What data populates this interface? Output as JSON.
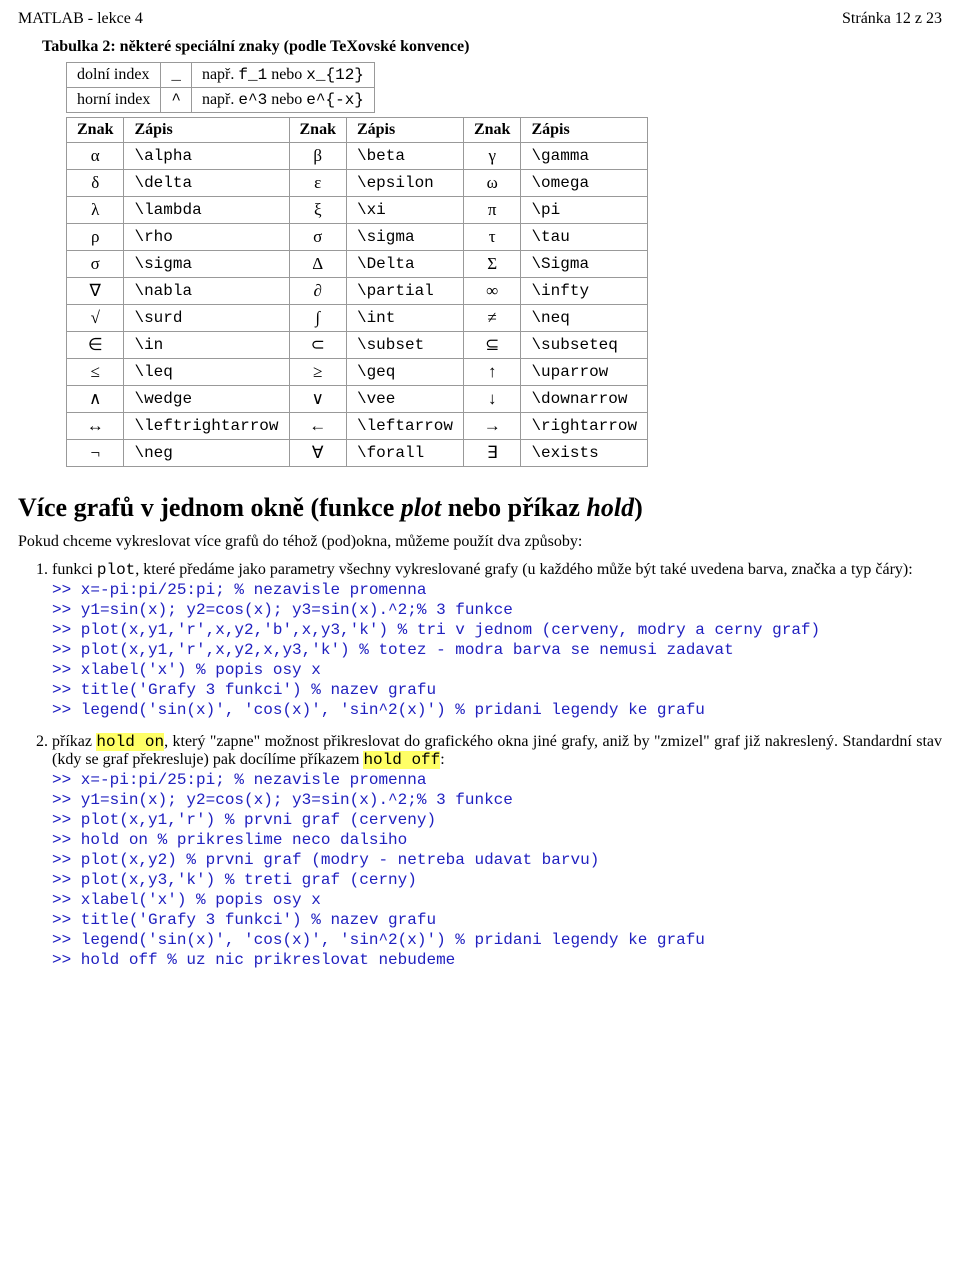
{
  "header": {
    "left": "MATLAB - lekce 4",
    "right": "Stránka 12 z 23"
  },
  "table2": {
    "caption": "Tabulka 2: některé speciální znaky (podle TeXovské konvence)",
    "rows": [
      [
        "dolní index",
        "_",
        "např.",
        "f_1",
        "nebo",
        "x_{12}"
      ],
      [
        "horní index",
        "^",
        "např.",
        "e^3",
        "nebo",
        "e^{-x}"
      ]
    ],
    "hdr": [
      "Znak",
      "Zápis",
      "Znak",
      "Zápis",
      "Znak",
      "Zápis"
    ],
    "body": [
      [
        "α",
        "\\alpha",
        "β",
        "\\beta",
        "γ",
        "\\gamma"
      ],
      [
        "δ",
        "\\delta",
        "ε",
        "\\epsilon",
        "ω",
        "\\omega"
      ],
      [
        "λ",
        "\\lambda",
        "ξ",
        "\\xi",
        "π",
        "\\pi"
      ],
      [
        "ρ",
        "\\rho",
        "σ",
        "\\sigma",
        "τ",
        "\\tau"
      ],
      [
        "σ",
        "\\sigma",
        "Δ",
        "\\Delta",
        "Σ",
        "\\Sigma"
      ],
      [
        "∇",
        "\\nabla",
        "∂",
        "\\partial",
        "∞",
        "\\infty"
      ],
      [
        "√",
        "\\surd",
        "∫",
        "\\int",
        "≠",
        "\\neq"
      ],
      [
        "∈",
        "\\in",
        "⊂",
        "\\subset",
        "⊆",
        "\\subseteq"
      ],
      [
        "≤",
        "\\leq",
        "≥",
        "\\geq",
        "↑",
        "\\uparrow"
      ],
      [
        "∧",
        "\\wedge",
        "∨",
        "\\vee",
        "↓",
        "\\downarrow"
      ],
      [
        "↔",
        "\\leftrightarrow",
        "←",
        "\\leftarrow",
        "→",
        "\\rightarrow"
      ],
      [
        "¬",
        "\\neg",
        "∀",
        "\\forall",
        "∃",
        "\\exists"
      ]
    ]
  },
  "sectionTitle": [
    "Více grafů v jednom okně (funkce ",
    "plot",
    " nebo příkaz ",
    "hold",
    ")"
  ],
  "intro": "Pokud chceme vykreslovat více grafů do téhož (pod)okna, můžeme použít dva způsoby:",
  "item1": {
    "lead": [
      "funkci ",
      "plot",
      ", které předáme jako parametry všechny vykreslované grafy (u každého může být také uvedena barva, značka a typ čáry):"
    ],
    "code": [
      ">> x=-pi:pi/25:pi; % nezavisle promenna",
      ">> y1=sin(x); y2=cos(x); y3=sin(x).^2;% 3 funkce",
      ">> plot(x,y1,'r',x,y2,'b',x,y3,'k') % tri v jednom (cerveny, modry a cerny graf)",
      ">> plot(x,y1,'r',x,y2,x,y3,'k') % totez - modra barva se nemusi zadavat",
      ">> xlabel('x') % popis osy x",
      ">> title('Grafy 3 funkci') % nazev grafu",
      ">> legend('sin(x)', 'cos(x)', 'sin^2(x)') % pridani legendy ke grafu"
    ]
  },
  "item2": {
    "lead1": "příkaz ",
    "hi1": "hold on",
    "lead2": ", který \"zapne\" možnost přikreslovat do grafického okna jiné grafy, aniž by \"zmizel\" graf již nakreslený. Standardní stav (kdy se graf překresluje) pak docílíme příkazem ",
    "hi2": "hold off",
    "lead3": ":",
    "code": [
      ">> x=-pi:pi/25:pi; % nezavisle promenna",
      ">> y1=sin(x); y2=cos(x); y3=sin(x).^2;% 3 funkce",
      ">> plot(x,y1,'r') % prvni graf (cerveny)",
      ">> hold on % prikreslime neco dalsiho",
      ">> plot(x,y2) % prvni graf (modry - netreba udavat barvu)",
      ">> plot(x,y3,'k') % treti graf (cerny)",
      ">> xlabel('x') % popis osy x",
      ">> title('Grafy 3 funkci') % nazev grafu",
      ">> legend('sin(x)', 'cos(x)', 'sin^2(x)') % pridani legendy ke grafu",
      ">> hold off % uz nic prikreslovat nebudeme"
    ]
  }
}
